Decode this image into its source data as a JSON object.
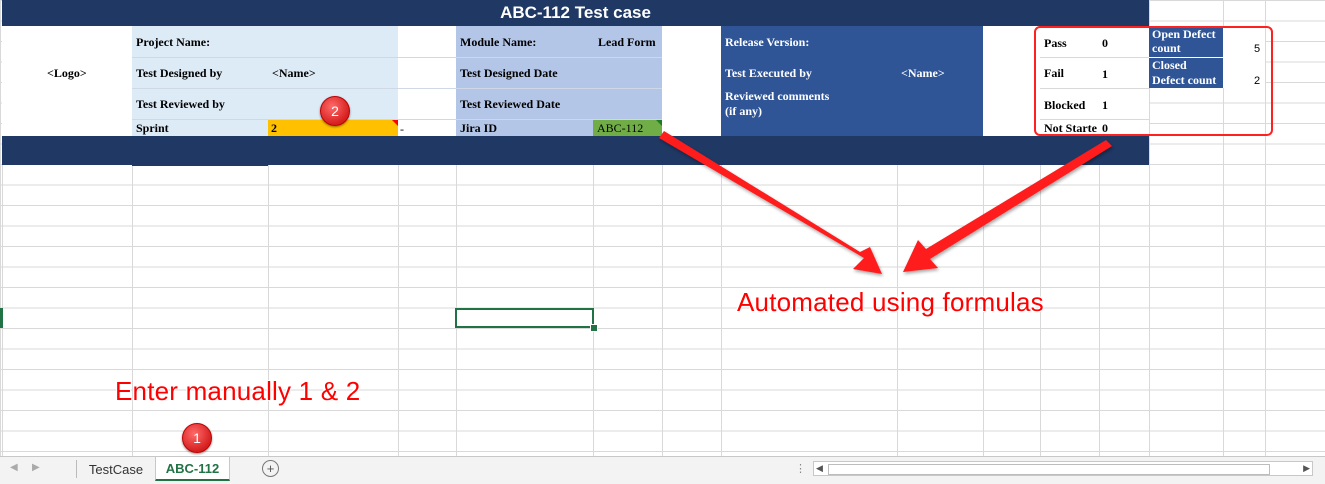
{
  "sheet": {
    "title": "ABC-112 Test case",
    "logo": "<Logo>",
    "left": {
      "project_label": "Project Name:",
      "designed_by_label": "Test Designed by",
      "designed_by_value": "<Name>",
      "reviewed_by_label": "Test Reviewed by",
      "sprint_label": "Sprint",
      "sprint_value": "2",
      "dash": "-"
    },
    "middle": {
      "module_label": "Module Name:",
      "module_value": "Lead Form",
      "designed_date_label": "Test Designed Date",
      "reviewed_date_label": "Test Reviewed Date",
      "jira_label": "Jira ID",
      "jira_value": "ABC-112"
    },
    "right": {
      "release_label": "Release Version:",
      "executed_by_label": "Test Executed by",
      "executed_by_value": "<Name>",
      "comments_label_1": "Reviewed comments",
      "comments_label_2": "(if any)"
    },
    "stats": {
      "pass_label": "Pass",
      "pass_value": "0",
      "fail_label": "Fail",
      "fail_value": "1",
      "blocked_label": "Blocked",
      "blocked_value": "1",
      "notstarted_label": "Not Starte",
      "notstarted_value": "0"
    },
    "defects": {
      "open_label_1": "Open Defect",
      "open_label_2": "count",
      "open_value": "5",
      "closed_label_1": "Closed",
      "closed_label_2": "Defect count",
      "closed_value": "2"
    }
  },
  "annotations": {
    "auto_text": "Automated using formulas",
    "manual_text": "Enter manually 1 & 2",
    "badge_1": "1",
    "badge_2": "2"
  },
  "tabs": {
    "sheet1": "TestCase",
    "sheet2": "ABC-112",
    "add": "+"
  },
  "colors": {
    "title_navy": "#1f3864",
    "light_blue": "#ddebf7",
    "mid_blue": "#b4c6e7",
    "dark_blue": "#2f5597",
    "sprint_orange": "#ffc000",
    "jira_green": "#70ad47",
    "annotation_red": "#ff0000"
  }
}
